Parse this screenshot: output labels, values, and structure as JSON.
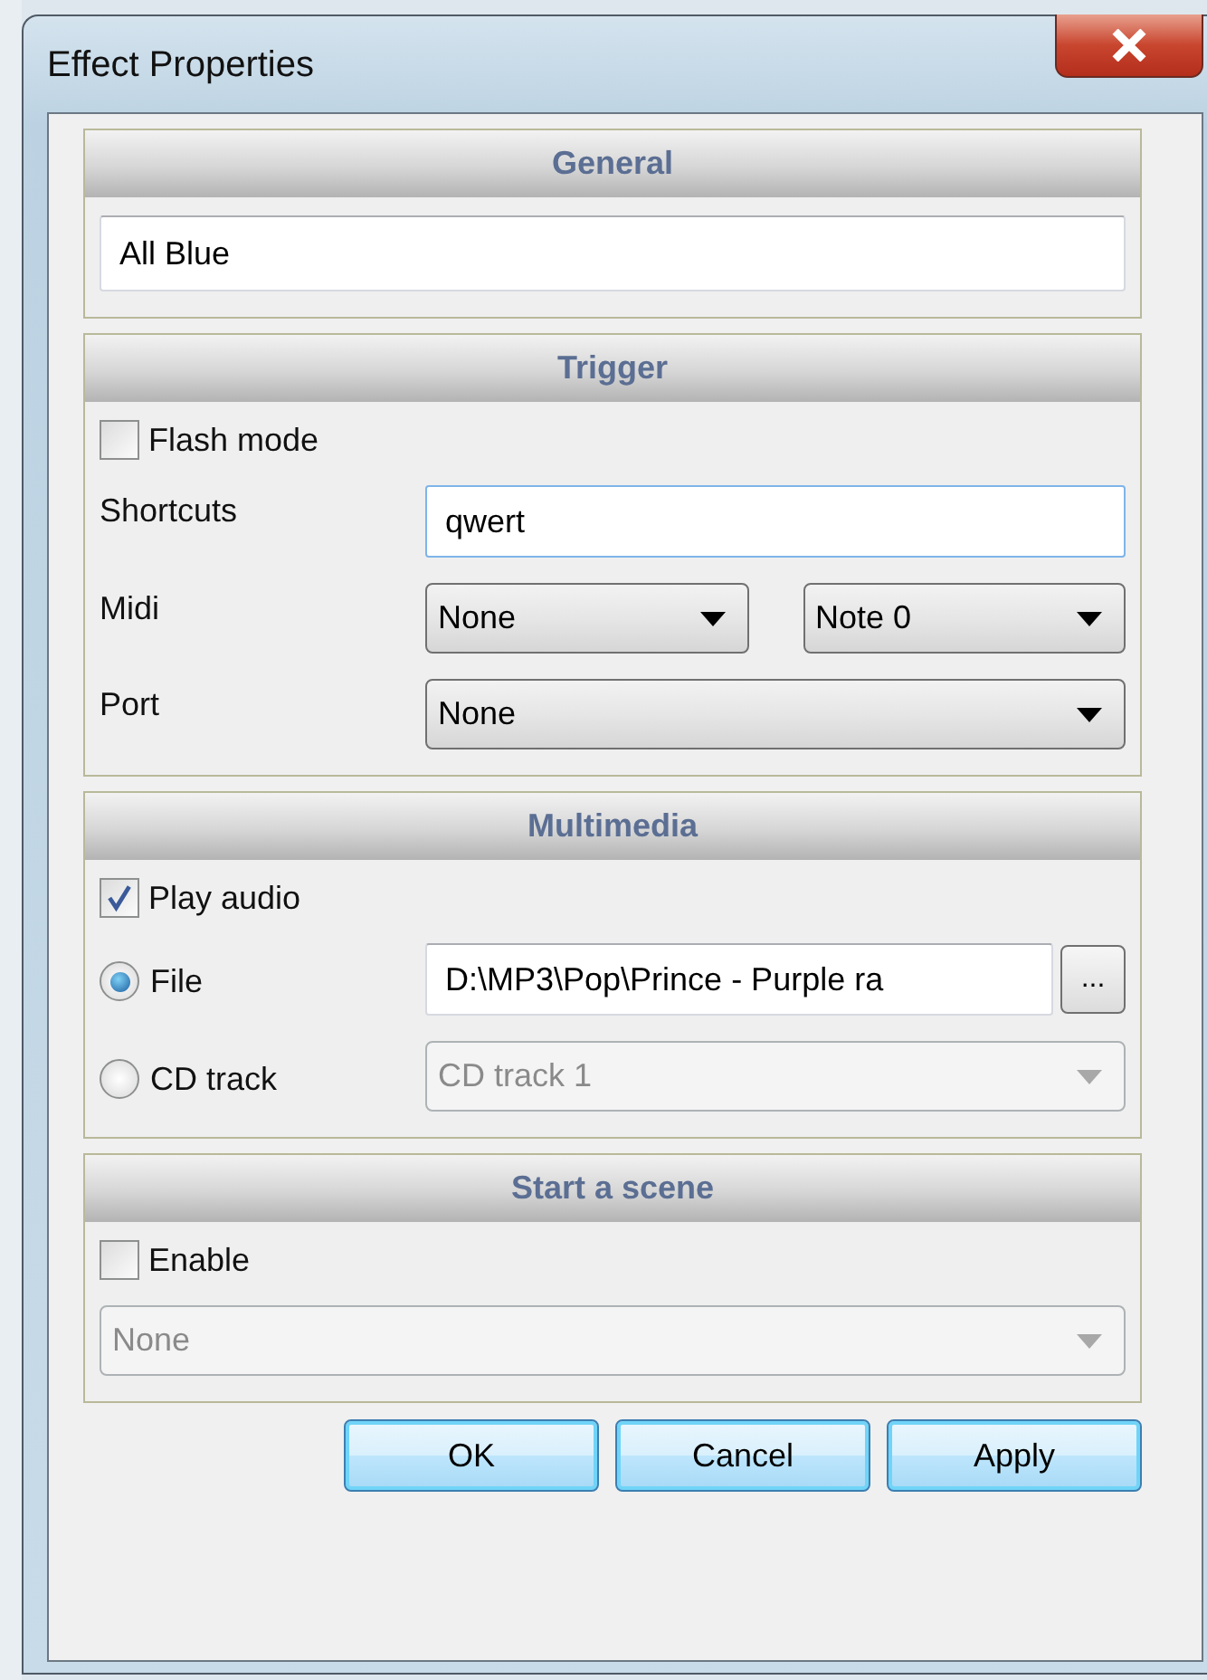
{
  "window": {
    "title": "Effect Properties"
  },
  "sections": [
    {
      "title": "General",
      "rows": [
        {
          "kind": "field",
          "input": {
            "value": "All Blue",
            "focused": false
          }
        }
      ]
    },
    {
      "title": "Trigger",
      "rows": [
        {
          "kind": "checkbox",
          "label": "Flash mode",
          "checked": false
        },
        {
          "kind": "field",
          "label": "Shortcuts",
          "input": {
            "value": "qwert",
            "focused": true
          }
        },
        {
          "kind": "field",
          "label": "Midi",
          "combos": [
            {
              "value": "None",
              "disabled": false
            },
            {
              "value": "Note 0",
              "disabled": false
            }
          ]
        },
        {
          "kind": "field",
          "label": "Port",
          "combos": [
            {
              "value": "None",
              "disabled": false
            }
          ]
        }
      ]
    },
    {
      "title": "Multimedia",
      "rows": [
        {
          "kind": "checkbox",
          "label": "Play audio",
          "checked": true
        },
        {
          "kind": "field",
          "radio": {
            "label": "File",
            "selected": true
          },
          "input": {
            "value": "D:\\MP3\\Pop\\Prince - Purple ra",
            "focused": false
          },
          "browse": "..."
        },
        {
          "kind": "field",
          "radio": {
            "label": "CD track",
            "selected": false
          },
          "combos": [
            {
              "value": "CD track 1",
              "disabled": true
            }
          ]
        }
      ]
    },
    {
      "title": "Start a scene",
      "rows": [
        {
          "kind": "checkbox",
          "label": "Enable",
          "checked": false
        },
        {
          "kind": "field",
          "combos": [
            {
              "value": "None",
              "disabled": true
            }
          ]
        }
      ]
    }
  ],
  "buttons": [
    {
      "label": "OK"
    },
    {
      "label": "Cancel"
    },
    {
      "label": "Apply"
    }
  ]
}
